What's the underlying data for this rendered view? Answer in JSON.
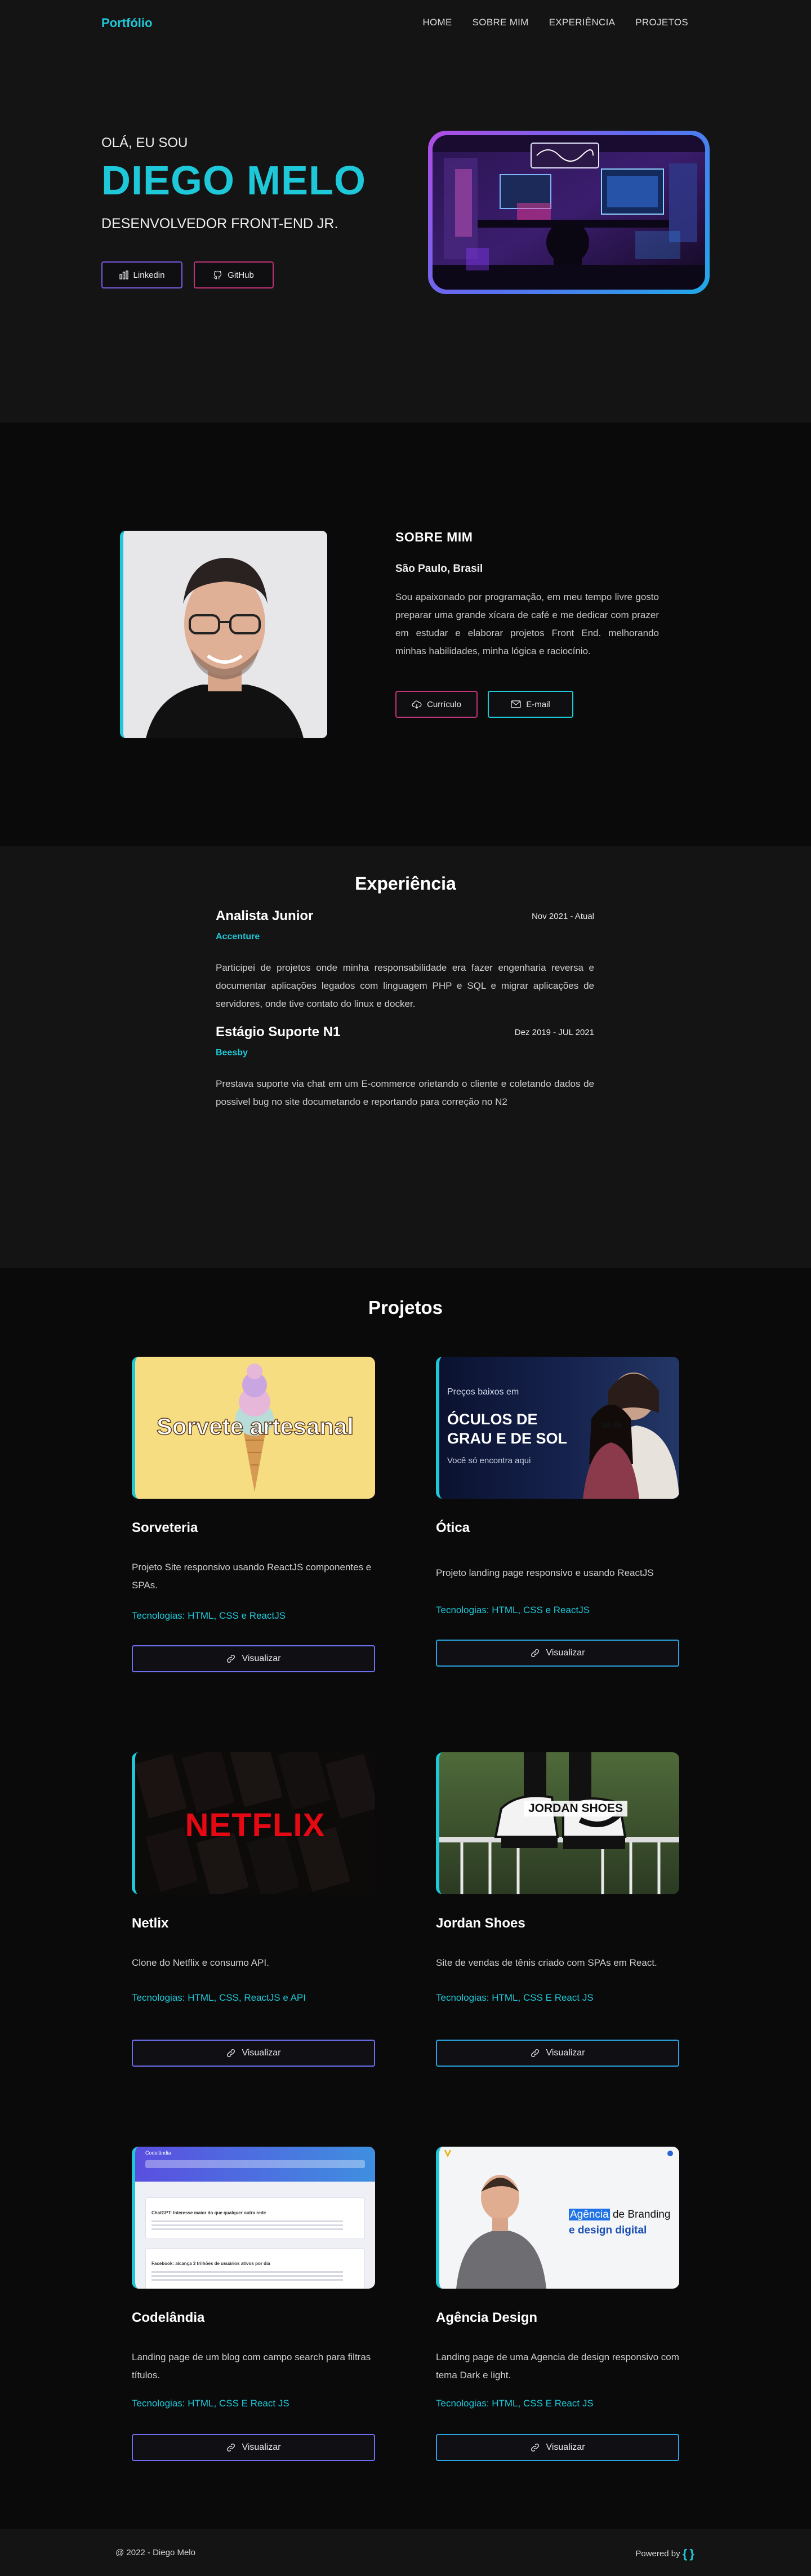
{
  "nav": {
    "logo": "Portfólio",
    "links": [
      "HOME",
      "SOBRE MIM",
      "EXPERIÊNCIA",
      "PROJETOS"
    ]
  },
  "hero": {
    "greeting": "OLÁ, EU SOU",
    "name": "DIEGO MELO",
    "role": "DESENVOLVEDOR FRONT-END JR.",
    "linkedin_label": "Linkedin",
    "github_label": "GitHub",
    "linkedin_icon": "bar-chart-icon",
    "github_icon": "github-icon"
  },
  "about": {
    "title": "SOBRE MIM",
    "location": "São Paulo, Brasil",
    "description": "Sou apaixonado por programação, em meu tempo livre gosto preparar uma grande xícara de café e me dedicar com prazer em estudar e elaborar projetos Front End. melhorando minhas habilidades, minha lógica e raciocínio.",
    "cv_label": "Currículo",
    "email_label": "E-mail"
  },
  "experience": {
    "title": "Experiência",
    "jobs": [
      {
        "title": "Analista Junior",
        "date": "Nov 2021 - Atual",
        "company": "Accenture",
        "text": "Participei de projetos onde minha responsabilidade era fazer engenharia reversa e documentar aplicações legados com linguagem PHP e SQL e migrar aplicações de servidores, onde tive contato do linux e docker."
      },
      {
        "title": "Estágio Suporte N1",
        "date": "Dez 2019 - JUL 2021",
        "company": "Beesby",
        "text": "Prestava suporte via chat em um E-commerce orietando o cliente e coletando dados de possivel bug no site documetando e reportando para correção no N2"
      }
    ]
  },
  "projects": {
    "title": "Projetos",
    "button_label": "Visualizar",
    "items": [
      {
        "title": "Sorveteria",
        "description": "Projeto Site responsivo usando ReactJS componentes e SPAs.",
        "tech": "Tecnologias: HTML, CSS e ReactJS",
        "thumb_text": "Sorvete artesanal"
      },
      {
        "title": "Ótica",
        "description": "Projeto landing page responsivo e usando ReactJS",
        "tech": "Tecnologias: HTML, CSS e ReactJS",
        "thumb_small": "Preços baixos em",
        "thumb_big1": "ÓCULOS DE",
        "thumb_big2": "GRAU E DE SOL",
        "thumb_tag": "Você só encontra aqui"
      },
      {
        "title": "Netlix",
        "description": "Clone do Netflix e consumo API.",
        "tech": "Tecnologias: HTML, CSS, ReactJS e API",
        "thumb_text": "NETFLIX"
      },
      {
        "title": "Jordan Shoes",
        "description": "Site de vendas de tênis criado com SPAs em React.",
        "tech": "Tecnologias: HTML, CSS E React JS",
        "thumb_text": "JORDAN SHOES"
      },
      {
        "title": "Codelândia",
        "description": "Landing page de um blog com campo search para filtras títulos.",
        "tech": "Tecnologias: HTML, CSS E React JS",
        "thumb_brand": "Codelândia",
        "thumb_post1": "ChatGPT: Interesse maior do que qualquer outra rede",
        "thumb_post2": "Facebook: alcança 3 trilhões de usuários ativos por dia"
      },
      {
        "title": "Agência Design",
        "description": "Landing page de uma Agencia de design responsivo com tema Dark e light.",
        "tech": "Tecnologias: HTML, CSS E React JS",
        "thumb_hl": "Agência",
        "thumb_rest": " de Branding",
        "thumb_line2": "e design digital"
      }
    ]
  },
  "footer": {
    "copyright": "@ 2022 - Diego Melo",
    "powered": "Powered by",
    "powered_mark": "{ }"
  },
  "colors": {
    "accent": "#1ec8d8",
    "purple": "#7b5ae0",
    "magenta": "#c0347a"
  }
}
